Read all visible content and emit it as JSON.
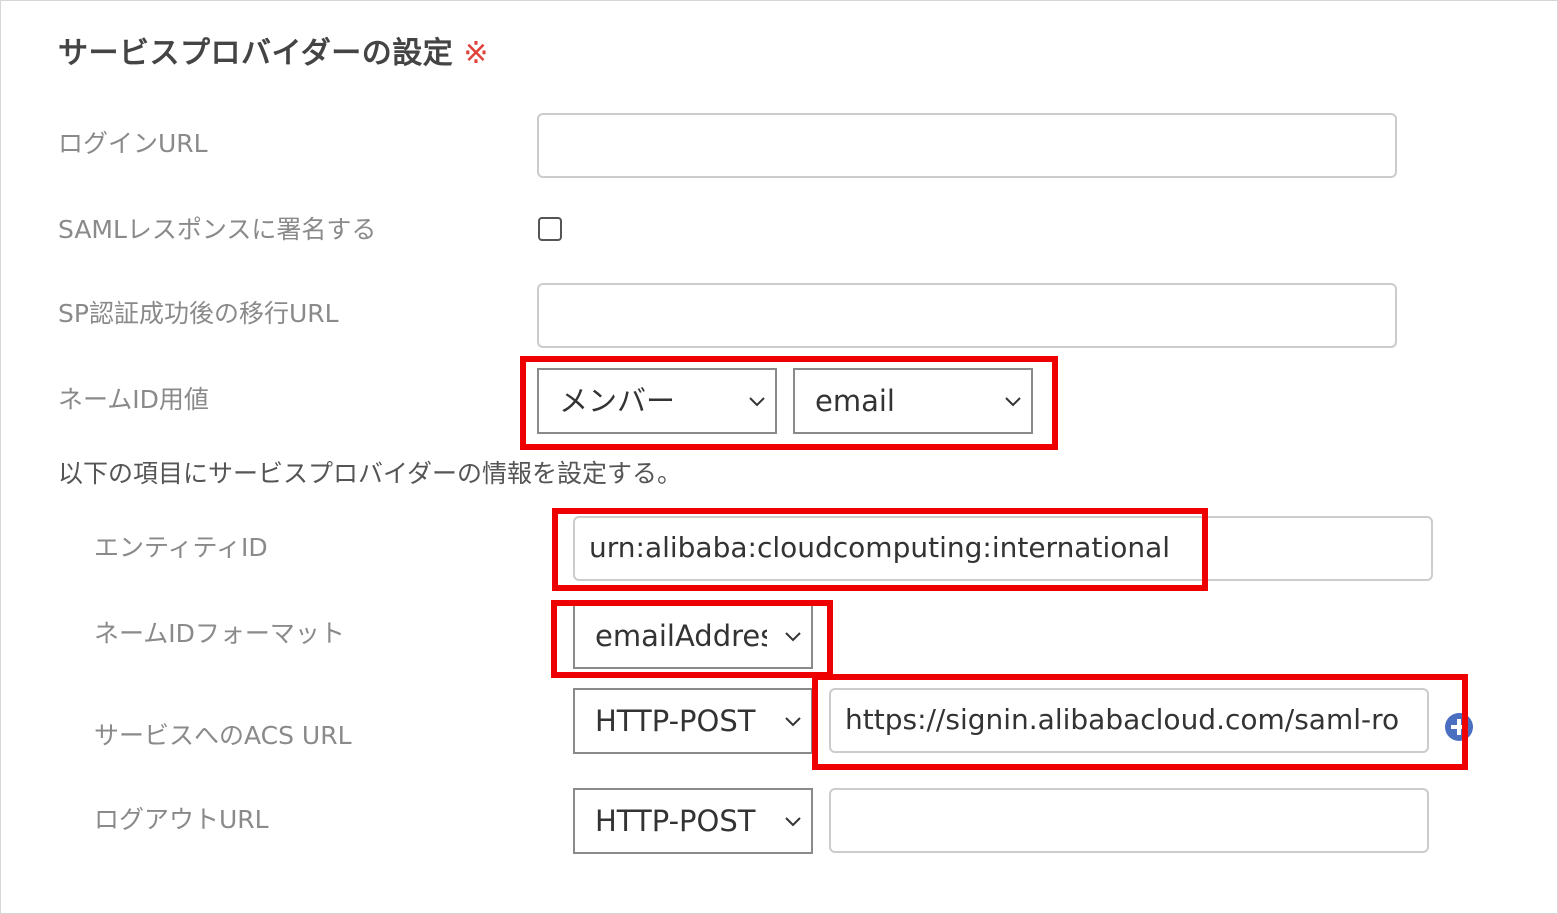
{
  "title": "サービスプロバイダーの設定",
  "required_mark": "※",
  "labels": {
    "login_url": "ログインURL",
    "sign_saml": "SAMLレスポンスに署名する",
    "sp_redirect": "SP認証成功後の移行URL",
    "name_id_value": "ネームID用値",
    "entity_id": "エンティティID",
    "name_id_format": "ネームIDフォーマット",
    "acs_url": "サービスへのACS URL",
    "logout_url": "ログアウトURL"
  },
  "note": "以下の項目にサービスプロバイダーの情報を設定する。",
  "fields": {
    "login_url_value": "",
    "sp_redirect_value": "",
    "sign_saml_checked": false,
    "name_id_source": "メンバー",
    "name_id_attr": "email",
    "entity_id_value": "urn:alibaba:cloudcomputing:international",
    "name_id_format": "emailAddress",
    "acs_binding": "HTTP-POST",
    "acs_url_value": "https://signin.alibabacloud.com/saml-ro",
    "logout_binding": "HTTP-POST",
    "logout_url_value": ""
  },
  "colors": {
    "highlight": "#ee0000",
    "required": "#e0413a",
    "add_button": "#4a6fc1"
  },
  "icons": {
    "select_arrow": "chevron-down-icon",
    "add": "plus-circle-icon"
  }
}
